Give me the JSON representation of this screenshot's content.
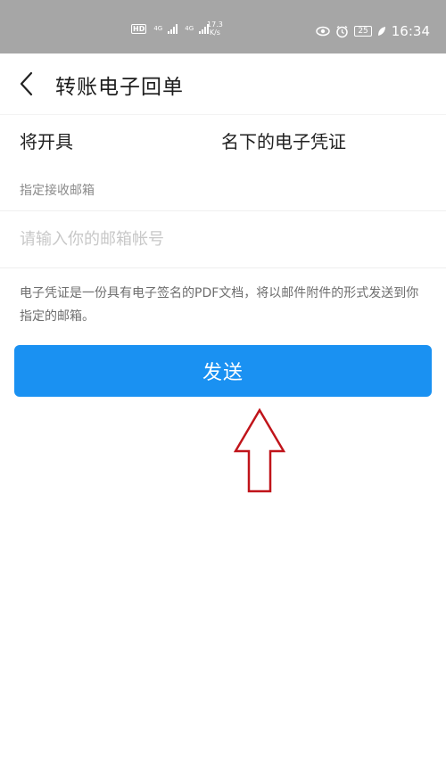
{
  "status_bar": {
    "hd_badge": "HD",
    "net1": "4G",
    "net2": "4G",
    "speed_value": "17.3",
    "speed_unit": "K/s",
    "battery": "25",
    "time": "16:34"
  },
  "header": {
    "title": "转账电子回单"
  },
  "content": {
    "line1_left": "将开具",
    "line1_right": "名下的电子凭证",
    "email_label": "指定接收邮箱",
    "email_placeholder": "请输入你的邮箱帐号",
    "email_value": "",
    "note": "电子凭证是一份具有电子签名的PDF文档，将以邮件附件的形式发送到你指定的邮箱。",
    "send_label": "发送"
  },
  "colors": {
    "accent": "#1a91f2",
    "status_bar": "#a6a6a6",
    "annotation_arrow": "#c0141a"
  },
  "icons": {
    "back": "chevron-left-icon",
    "eye": "eye-icon",
    "alarm": "alarm-clock-icon",
    "leaf": "leaf-icon"
  }
}
